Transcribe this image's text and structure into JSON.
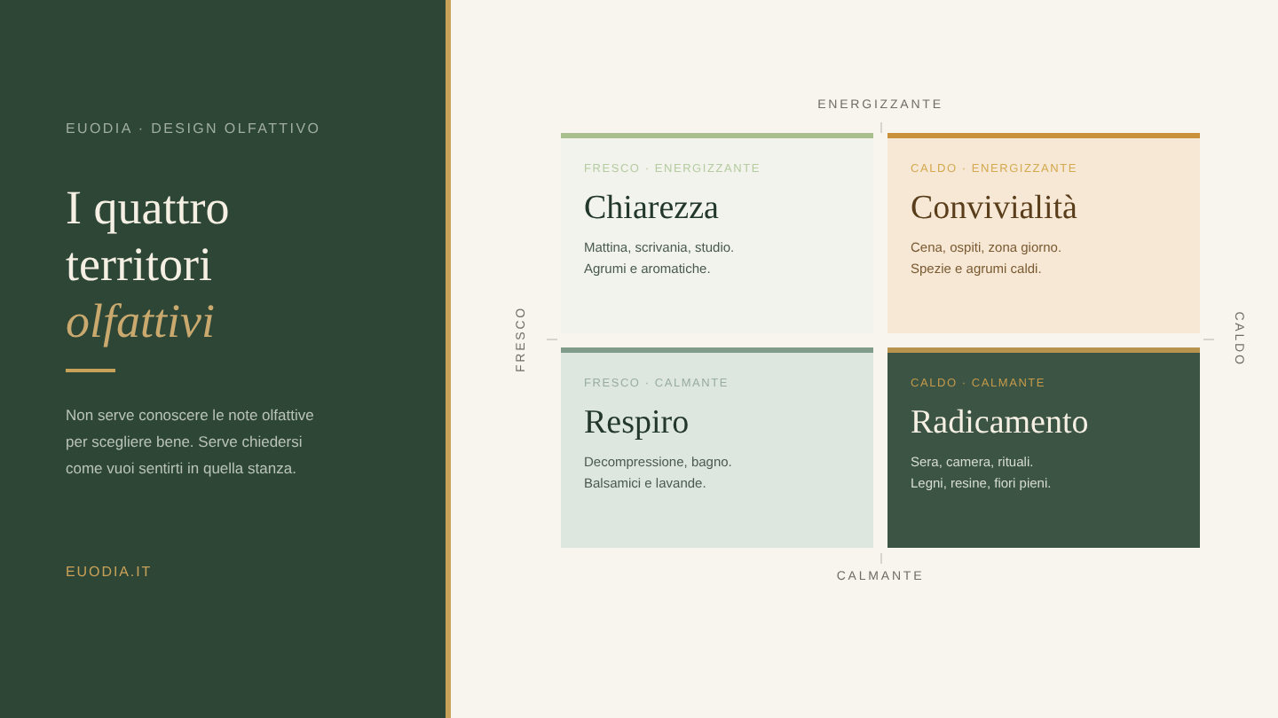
{
  "sidebar": {
    "eyebrow": "EUODIA · DESIGN OLFATTIVO",
    "title_lines": [
      "I quattro",
      "territori"
    ],
    "title_accent": "olfattivi",
    "intro": "Non serve conoscere le note olfattive per scegliere bene. Serve chiedersi come vuoi sentirti in quella stanza.",
    "footer": "EUODIA.IT"
  },
  "axes": {
    "top": "ENERGIZZANTE",
    "bottom": "CALMANTE",
    "left": "FRESCO",
    "right": "CALDO"
  },
  "cards": [
    {
      "kind": "pale",
      "color": "#a9bf8e",
      "tag": "FRESCO · ENERGIZZANTE",
      "title": "Chiarezza",
      "lines": [
        "Mattina, scrivania, studio.",
        "Agrumi e aromatiche."
      ]
    },
    {
      "kind": "cream",
      "color": "#c9913a",
      "tag": "CALDO · ENERGIZZANTE",
      "title": "Convivialità",
      "lines": [
        "Cena, ospiti, zona giorno.",
        "Spezie e agrumi caldi."
      ]
    },
    {
      "kind": "mint",
      "color": "#7f9d8a",
      "tag": "FRESCO · CALMANTE",
      "title": "Respiro",
      "lines": [
        "Decompressione, bagno.",
        "Balsamici e lavande."
      ]
    },
    {
      "kind": "forest",
      "color": "#b8934d",
      "tag": "CALDO · CALMANTE",
      "title": "Radicamento",
      "lines": [
        "Sera, camera, rituali.",
        "Legni, resine, fiori pieni."
      ]
    }
  ]
}
